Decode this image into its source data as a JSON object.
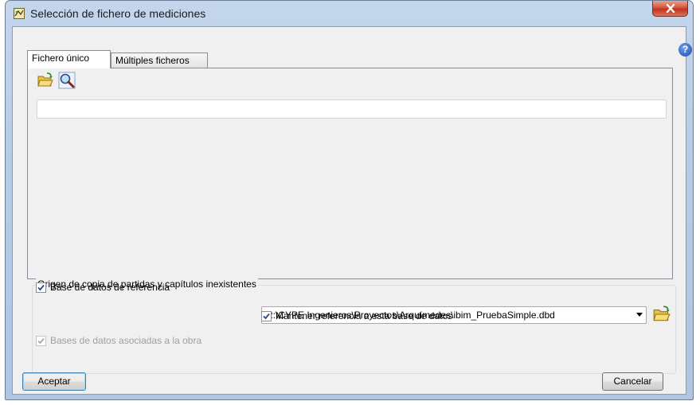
{
  "window": {
    "title": "Selección de fichero de mediciones",
    "help_icon": "?"
  },
  "tabs": [
    {
      "label": "Fichero único",
      "active": true
    },
    {
      "label": "Múltiples ficheros",
      "active": false
    }
  ],
  "toolbar": {
    "open_icon": "folder-open-icon",
    "search_icon": "magnifier-icon"
  },
  "file_path": {
    "value": ""
  },
  "origin_group": {
    "legend": "Origen de copia de partidas y capítulos inexistentes",
    "reference_db": {
      "label": "Base de datos de referencia",
      "checked": true
    },
    "reference_db_path": "R:\\CYPE Ingenieros\\Proyectos\\Arquímedes\\ibim_PruebaSimple.dbd",
    "keep_reference": {
      "label": "Mantener referencia a esta base de datos",
      "checked": true
    },
    "associated_dbs": {
      "label": "Bases de datos asociadas a la obra",
      "checked": true,
      "enabled": false
    }
  },
  "buttons": {
    "accept": "Aceptar",
    "cancel": "Cancelar"
  }
}
